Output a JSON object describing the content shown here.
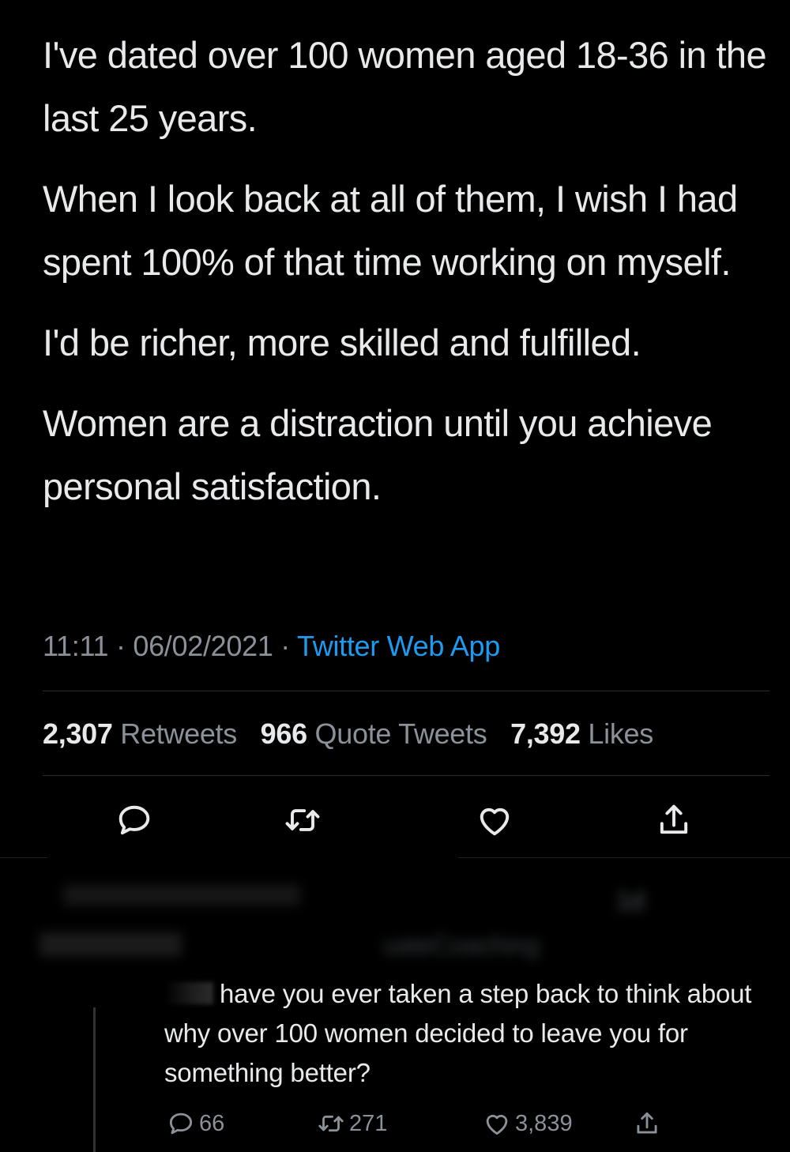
{
  "tweet": {
    "paragraphs": [
      "I've dated over 100 women aged 18-36 in the last 25 years.",
      "When I look back at all of them, I wish I had spent 100% of that time working on myself.",
      "I'd be richer, more skilled and fulfilled.",
      "Women are a distraction until you achieve personal satisfaction."
    ],
    "time": "11:11",
    "date": "06/02/2021",
    "separator": "·",
    "source": "Twitter Web App",
    "stats": {
      "retweets_count": "2,307",
      "retweets_label": "Retweets",
      "quotes_count": "966",
      "quotes_label": "Quote Tweets",
      "likes_count": "7,392",
      "likes_label": "Likes"
    },
    "actions": [
      "reply-icon",
      "retweet-icon",
      "like-icon",
      "share-icon"
    ]
  },
  "reply": {
    "blurred_header_fragment": "1d",
    "blurred_handle_fragment": "uateCoaching",
    "text": "have you ever taken a step back to think about why over 100 women decided to leave you for something better?",
    "reply_count": "66",
    "retweet_count": "271",
    "like_count": "3,839",
    "icons": [
      "reply-icon",
      "retweet-icon",
      "like-icon",
      "share-icon"
    ]
  },
  "colors": {
    "background": "#000000",
    "text": "#e7e9ea",
    "muted": "#8b9198",
    "accent": "#1d9bf0",
    "divider": "#2a2d30"
  }
}
